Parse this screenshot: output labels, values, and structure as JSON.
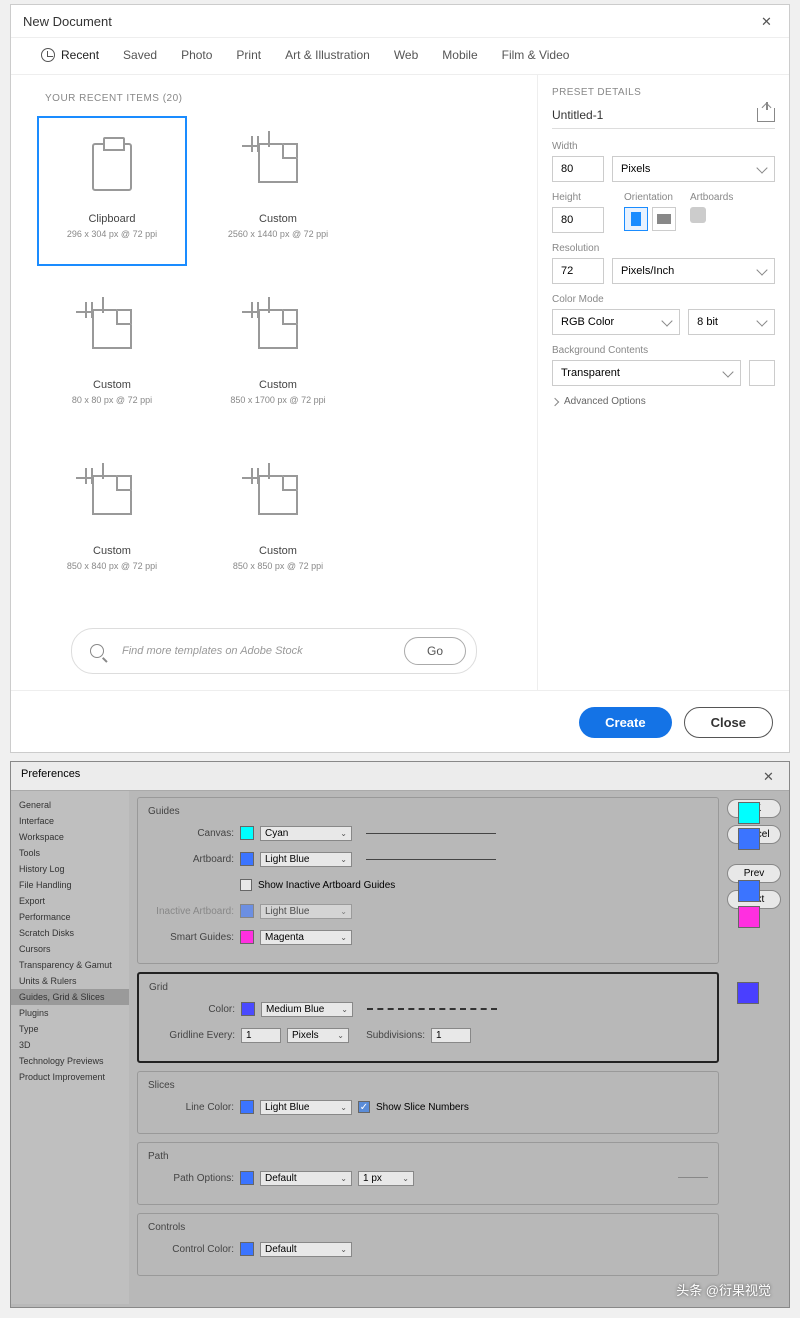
{
  "newdoc": {
    "title": "New Document",
    "tabs": [
      "Recent",
      "Saved",
      "Photo",
      "Print",
      "Art & Illustration",
      "Web",
      "Mobile",
      "Film & Video"
    ],
    "recent_header": "YOUR RECENT ITEMS  (20)",
    "presets": [
      {
        "name": "Clipboard",
        "dim": "296 x 304 px @ 72 ppi",
        "type": "clip"
      },
      {
        "name": "Custom",
        "dim": "2560 x 1440 px @ 72 ppi",
        "type": "cust"
      },
      {
        "name": "Custom",
        "dim": "80 x 80 px @ 72 ppi",
        "type": "cust"
      },
      {
        "name": "Custom",
        "dim": "850 x 1700 px @ 72 ppi",
        "type": "cust"
      },
      {
        "name": "Custom",
        "dim": "850 x 840 px @ 72 ppi",
        "type": "cust"
      },
      {
        "name": "Custom",
        "dim": "850 x 850 px @ 72 ppi",
        "type": "cust"
      }
    ],
    "search_placeholder": "Find more templates on Adobe Stock",
    "go": "Go",
    "details": {
      "header": "PRESET DETAILS",
      "name": "Untitled-1",
      "width_label": "Width",
      "width": "80",
      "width_unit": "Pixels",
      "height_label": "Height",
      "height": "80",
      "orientation_label": "Orientation",
      "artboards_label": "Artboards",
      "resolution_label": "Resolution",
      "resolution": "72",
      "resolution_unit": "Pixels/Inch",
      "color_mode_label": "Color Mode",
      "color_mode": "RGB Color",
      "color_depth": "8 bit",
      "bg_label": "Background Contents",
      "bg": "Transparent",
      "advanced": "Advanced Options"
    },
    "create": "Create",
    "close": "Close"
  },
  "prefs": {
    "title": "Preferences",
    "sidebar": [
      "General",
      "Interface",
      "Workspace",
      "Tools",
      "History Log",
      "File Handling",
      "Export",
      "Performance",
      "Scratch Disks",
      "Cursors",
      "Transparency & Gamut",
      "Units & Rulers",
      "Guides, Grid & Slices",
      "Plugins",
      "Type",
      "3D",
      "Technology Previews",
      "Product Improvement"
    ],
    "selected_sidebar_index": 12,
    "buttons": {
      "ok": "OK",
      "cancel": "Cancel",
      "prev": "Prev",
      "next": "Next"
    },
    "guides": {
      "title": "Guides",
      "canvas_label": "Canvas:",
      "canvas_val": "Cyan",
      "canvas_color": "#00ffff",
      "artboard_label": "Artboard:",
      "artboard_val": "Light Blue",
      "artboard_color": "#3b74ff",
      "show_inactive": "Show Inactive Artboard Guides",
      "inactive_label": "Inactive Artboard:",
      "inactive_val": "Light Blue",
      "inactive_color": "#3b74ff",
      "smart_label": "Smart Guides:",
      "smart_val": "Magenta",
      "smart_color": "#ff2fe0"
    },
    "grid": {
      "title": "Grid",
      "color_label": "Color:",
      "color_val": "Medium Blue",
      "color": "#4a4aff",
      "gridline_label": "Gridline Every:",
      "gridline_val": "1",
      "gridline_unit": "Pixels",
      "subdiv_label": "Subdivisions:",
      "subdiv_val": "1",
      "swatch": "#4a3fff"
    },
    "slices": {
      "title": "Slices",
      "line_label": "Line Color:",
      "line_val": "Light Blue",
      "line_color": "#3b74ff",
      "show_nums": "Show Slice Numbers"
    },
    "path": {
      "title": "Path",
      "opts_label": "Path Options:",
      "opts_val": "Default",
      "opts_color": "#3b74ff",
      "width": "1 px"
    },
    "controls": {
      "title": "Controls",
      "ctrl_label": "Control Color:",
      "ctrl_val": "Default",
      "ctrl_color": "#3b74ff"
    }
  },
  "watermark": "头条 @衍果视觉"
}
